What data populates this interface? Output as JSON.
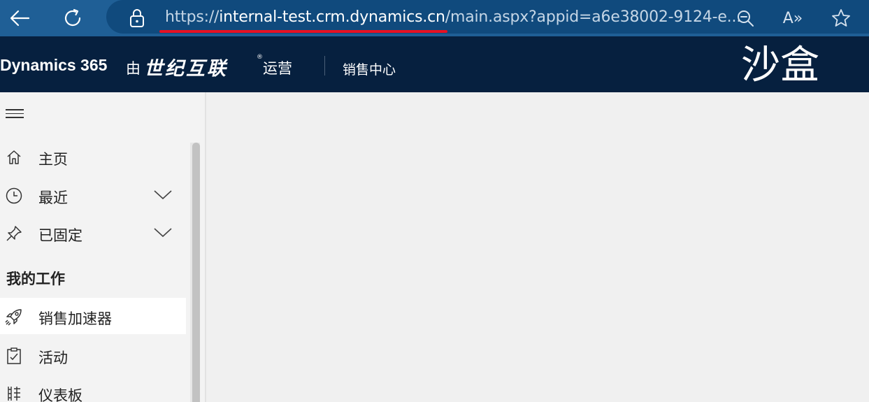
{
  "browser": {
    "url_scheme": "https://",
    "url_host": "internal-test.crm.dynamics.cn",
    "url_path": "/main.aspx?appid=a6e38002-9124-e...",
    "icons": [
      "back-icon",
      "refresh-icon",
      "lock-icon",
      "zoom-out-icon",
      "read-aloud-icon",
      "favorite-icon"
    ],
    "read_aloud_label": "A»",
    "accent": "#e81123"
  },
  "header": {
    "brand": "Dynamics 365",
    "operated_prefix": "由",
    "operator_logo": "世纪互联",
    "operator_reg": "®",
    "operated_suffix": "运营",
    "app_name": "销售中心",
    "environment": "沙盒",
    "background": "#06203f"
  },
  "sidebar": {
    "items": [
      {
        "label": "主页",
        "icon": "home-icon",
        "expandable": false
      },
      {
        "label": "最近",
        "icon": "clock-icon",
        "expandable": true
      },
      {
        "label": "已固定",
        "icon": "pin-icon",
        "expandable": true
      }
    ],
    "section_title": "我的工作",
    "work_items": [
      {
        "label": "销售加速器",
        "icon": "rocket-icon",
        "selected": true
      },
      {
        "label": "活动",
        "icon": "clipboard-icon",
        "selected": false
      },
      {
        "label": "仪表板",
        "icon": "dashboard-icon",
        "selected": false
      }
    ]
  }
}
